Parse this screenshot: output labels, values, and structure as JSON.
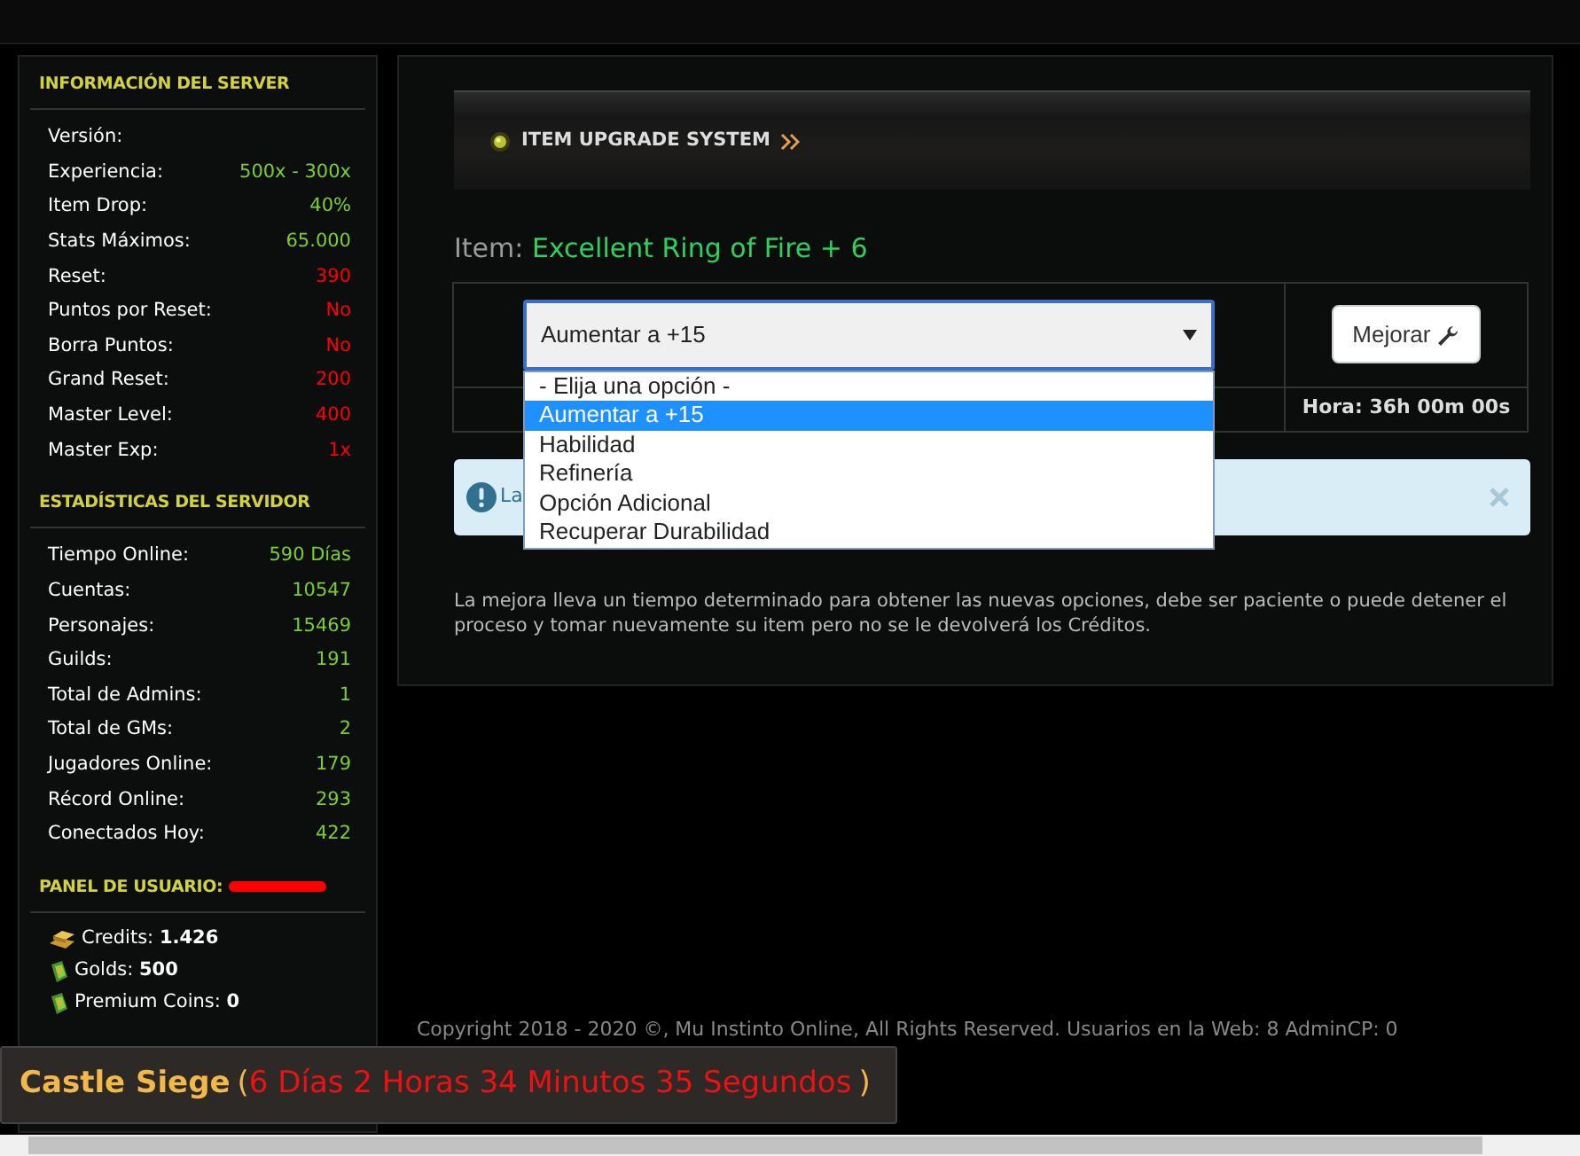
{
  "sidebar": {
    "sections": [
      {
        "title": "INFORMACIÓN DEL SERVER",
        "rows": [
          {
            "label": "Versión:"
          },
          {
            "label": "Experiencia:",
            "value": "500x - 300x",
            "color": "#7ccf2a"
          },
          {
            "label": "Item Drop:",
            "value": "40%",
            "color": "#7ccf2a"
          },
          {
            "label": "Stats Máximos:",
            "value": "65.000",
            "color": "#7ccf2a"
          },
          {
            "label": "Reset:",
            "value": "390",
            "color": "#ff0000"
          },
          {
            "label": "Puntos por Reset:",
            "value": "No",
            "color": "#ff0000"
          },
          {
            "label": "Borra Puntos:",
            "value": "No",
            "color": "#ff0000"
          },
          {
            "label": "Grand Reset:",
            "value": "200",
            "color": "#ff0000"
          },
          {
            "label": "Master Level:",
            "value": "400",
            "color": "#ff0000"
          },
          {
            "label": "Master Exp:",
            "value": "1x",
            "color": "#ff0000"
          }
        ]
      },
      {
        "title": "ESTADÍSTICAS DEL SERVIDOR",
        "rows": [
          {
            "label": "Tiempo Online:",
            "value": "590 Días",
            "color": "#7ccf2a"
          },
          {
            "label": "Cuentas:",
            "value": "10547",
            "color": "#7ccf2a"
          },
          {
            "label": "Personajes:",
            "value": "15469",
            "color": "#7ccf2a"
          },
          {
            "label": "Guilds:",
            "value": "191",
            "color": "#7ccf2a"
          },
          {
            "label": "Total de Admins:",
            "value": "1",
            "color": "#7ccf2a"
          },
          {
            "label": "Total de GMs:",
            "value": "2",
            "color": "#7ccf2a"
          },
          {
            "label": "Jugadores Online:",
            "value": "179",
            "color": "#7ccf2a"
          },
          {
            "label": "Récord Online:",
            "value": "293",
            "color": "#7ccf2a"
          },
          {
            "label": "Conectados Hoy:",
            "value": "422",
            "color": "#7ccf2a"
          }
        ]
      }
    ]
  },
  "user_panel": {
    "title": "PANEL DE USUARIO:",
    "redacted": true,
    "balances": [
      {
        "label": "Credits:",
        "amount": "1.426",
        "kind": "gold-bars"
      },
      {
        "label": "Golds:",
        "amount": "500",
        "kind": "money"
      },
      {
        "label": "Premium Coins:",
        "amount": "0",
        "kind": "money"
      }
    ]
  },
  "banner": {
    "title": "ITEM UPGRADE SYSTEM"
  },
  "item": {
    "label": "Item:",
    "name": "Excellent Ring of Fire + 6"
  },
  "upgrade_form": {
    "select": {
      "value": "Aumentar a +15",
      "expanded": true,
      "options": [
        {
          "label": "- Elija una opción -",
          "selected": false
        },
        {
          "label": "Aumentar a +15",
          "selected": true
        },
        {
          "label": "Habilidad",
          "selected": false
        },
        {
          "label": "Refinería",
          "selected": false
        },
        {
          "label": "Opción Adicional",
          "selected": false
        },
        {
          "label": "Recuperar Durabilidad",
          "selected": false
        }
      ]
    },
    "button": "Mejorar",
    "timer": "Hora: 36h 00m 00s"
  },
  "alert": {
    "text": "La"
  },
  "note": "La mejora lleva un tiempo determinado para obtener las nuevas opciones, debe ser paciente o puede detener el proceso y tomar nuevamente su item pero no se le devolverá los Créditos.",
  "castle_siege": {
    "title": "Castle Siege",
    "open": "(",
    "countdown": "6 Días 2 Horas 34 Minutos 35 Segundos",
    "close": ")"
  },
  "footer": "Copyright 2018 - 2020 ©, Mu Instinto Online, All Rights Reserved. Usuarios en la Web: 8 AdminCP: 0"
}
